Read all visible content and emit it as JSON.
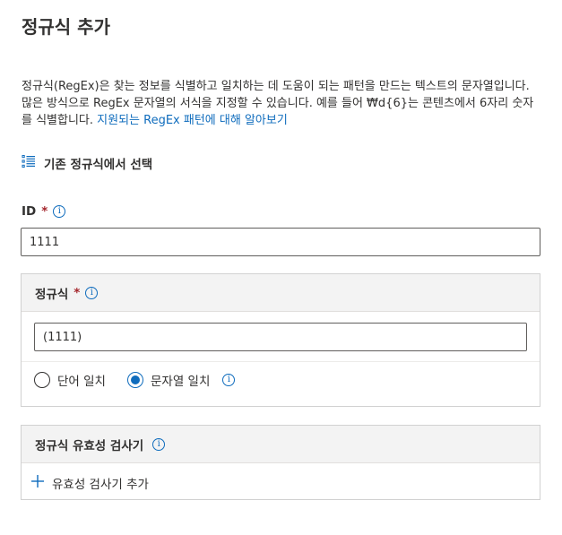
{
  "page": {
    "title": "정규식 추가",
    "description_text": "정규식(RegEx)은 찾는 정보를 식별하고 일치하는 데 도움이 되는 패턴을 만드는 텍스트의 문자열입니다. 많은 방식으로 RegEx 문자열의 서식을 지정할 수 있습니다. 예를 들어 ₩d{6}는 콘텐츠에서 6자리 숫자를 식별합니다. ",
    "description_link": "지원되는 RegEx 패턴에 대해 알아보기",
    "select_existing_label": "기존 정규식에서 선택",
    "select_existing_icon": "list-icon"
  },
  "id_field": {
    "label": "ID",
    "required_mark": "*",
    "info_icon": "i",
    "value": "1111"
  },
  "regex_section": {
    "header": "정규식",
    "required_mark": "*",
    "info_icon": "i",
    "value": "(1111)",
    "options": [
      {
        "label": "단어 일치",
        "selected": false
      },
      {
        "label": "문자열 일치",
        "selected": true
      }
    ],
    "option_info_icon": "i"
  },
  "validator_section": {
    "header": "정규식 유효성 검사기",
    "info_icon": "i",
    "add_label": "유효성 검사기 추가",
    "add_icon": "plus-icon"
  },
  "colors": {
    "accent": "#0f6cbd",
    "required": "#a4262c",
    "panel_header_bg": "#f3f3f3"
  }
}
